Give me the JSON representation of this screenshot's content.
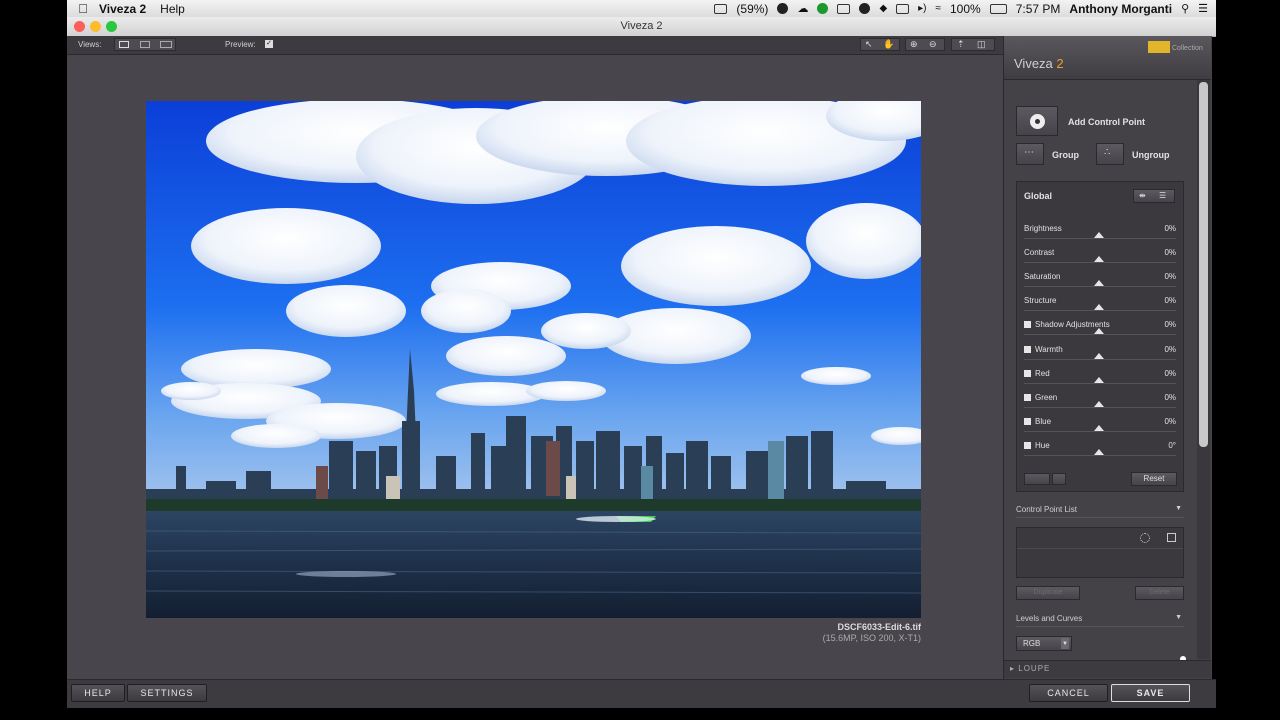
{
  "menubar": {
    "app_name": "Viveza 2",
    "help": "Help",
    "battery_1": "(59%)",
    "battery_2": "100%",
    "time": "7:57 PM",
    "user": "Anthony Morganti"
  },
  "window": {
    "title": "Viveza 2"
  },
  "toolbar": {
    "views_label": "Views:",
    "preview_label": "Preview:"
  },
  "photo": {
    "filename": "DSCF6033-Edit-6.tif",
    "meta": "(15.6MP, ISO 200, X-T1)"
  },
  "panel": {
    "brand_text": "Collection",
    "title_main": "Viveza",
    "title_num": "2",
    "add_control_point": "Add Control Point",
    "group": "Group",
    "ungroup": "Ungroup",
    "global": "Global",
    "sliders": [
      {
        "label": "Brightness",
        "value": "0%",
        "checkbox": false
      },
      {
        "label": "Contrast",
        "value": "0%",
        "checkbox": false
      },
      {
        "label": "Saturation",
        "value": "0%",
        "checkbox": false
      },
      {
        "label": "Structure",
        "value": "0%",
        "checkbox": false
      },
      {
        "label": "Shadow Adjustments",
        "value": "0%",
        "checkbox": true
      },
      {
        "label": "Warmth",
        "value": "0%",
        "checkbox": true
      },
      {
        "label": "Red",
        "value": "0%",
        "checkbox": true
      },
      {
        "label": "Green",
        "value": "0%",
        "checkbox": true
      },
      {
        "label": "Blue",
        "value": "0%",
        "checkbox": true
      },
      {
        "label": "Hue",
        "value": "0°",
        "checkbox": true
      }
    ],
    "reset": "Reset",
    "control_point_list": "Control Point List",
    "duplicate": "Duplicate",
    "delete": "Delete",
    "levels_and_curves": "Levels and Curves",
    "rgb": "RGB",
    "loupe": "LOUPE"
  },
  "bottom": {
    "help": "HELP",
    "settings": "SETTINGS",
    "cancel": "CANCEL",
    "save": "SAVE"
  },
  "colors": {
    "accent": "#e9a02a",
    "panel_bg": "#444246",
    "canvas_bg": "#48464c"
  }
}
